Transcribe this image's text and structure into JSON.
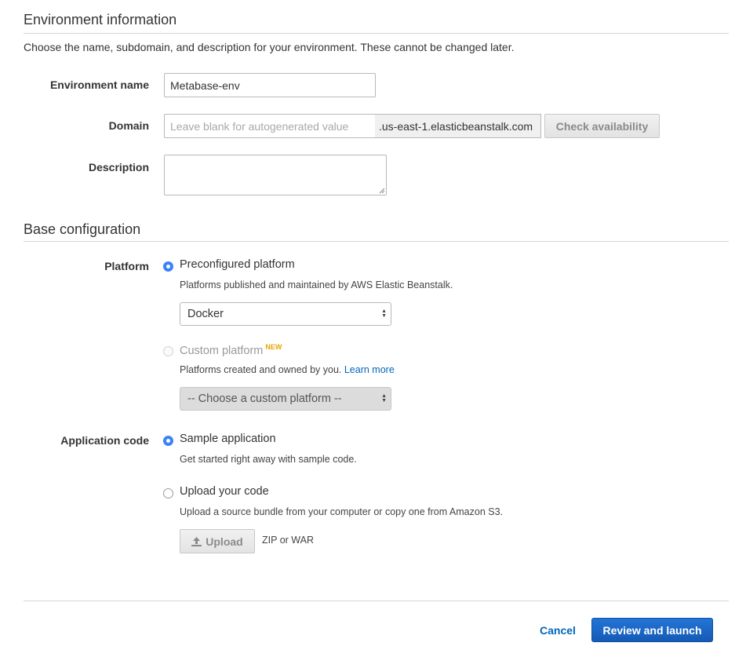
{
  "env_info": {
    "title": "Environment information",
    "description": "Choose the name, subdomain, and description for your environment. These cannot be changed later.",
    "name_label": "Environment name",
    "name_value": "Metabase-env",
    "domain_label": "Domain",
    "domain_placeholder": "Leave blank for autogenerated value",
    "domain_suffix": ".us-east-1.elasticbeanstalk.com",
    "check_availability": "Check availability",
    "description_label": "Description",
    "description_value": ""
  },
  "base_config": {
    "title": "Base configuration",
    "platform_label": "Platform",
    "preconfigured": {
      "label": "Preconfigured platform",
      "help": "Platforms published and maintained by AWS Elastic Beanstalk.",
      "selected": "Docker",
      "checked": true
    },
    "custom": {
      "label": "Custom platform",
      "badge": "NEW",
      "help": "Platforms created and owned by you.",
      "learn_more": "Learn more",
      "selected": "-- Choose a custom platform --",
      "checked": false,
      "disabled": true
    },
    "app_code_label": "Application code",
    "sample": {
      "label": "Sample application",
      "help": "Get started right away with sample code.",
      "checked": true
    },
    "upload": {
      "label": "Upload your code",
      "help": "Upload a source bundle from your computer or copy one from Amazon S3.",
      "button": "Upload",
      "hint": "ZIP or WAR",
      "checked": false
    }
  },
  "footer": {
    "cancel": "Cancel",
    "review": "Review and launch"
  },
  "colors": {
    "accent": "#3b82f6",
    "primary_button": "#1a66c6",
    "link": "#0066bb",
    "new_badge": "#e6a700"
  }
}
